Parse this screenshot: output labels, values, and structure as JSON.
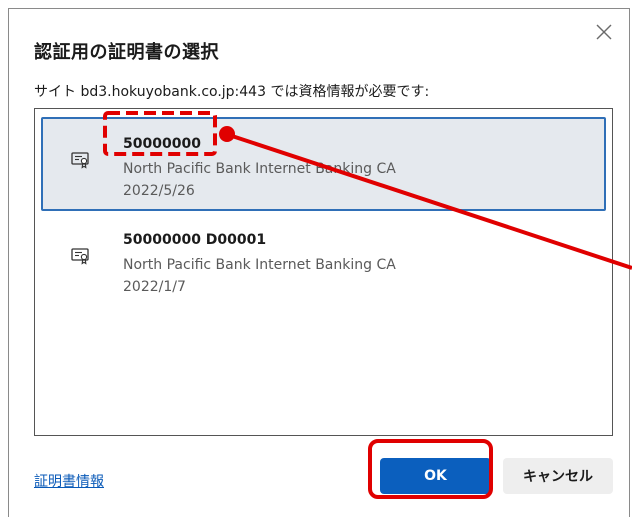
{
  "dialog": {
    "title": "認証用の証明書の選択",
    "subtitle": "サイト bd3.hokuyobank.co.jp:443 では資格情報が必要です:",
    "close_icon": "close-icon"
  },
  "certificates": [
    {
      "name": "50000000",
      "issuer": "North Pacific Bank Internet Banking CA",
      "date": "2022/5/26",
      "selected": true,
      "icon": "certificate-icon"
    },
    {
      "name": "50000000 D00001",
      "issuer": "North Pacific Bank Internet Banking CA",
      "date": "2022/1/7",
      "selected": false,
      "icon": "certificate-icon"
    }
  ],
  "footer": {
    "cert_info_label": "証明書情報",
    "ok_label": "OK",
    "cancel_label": "キャンセル"
  },
  "colors": {
    "accent": "#0b5fbe",
    "selected_bg": "#e5e9ee",
    "selected_border": "#2f6fb7",
    "annotation": "#e00000"
  }
}
